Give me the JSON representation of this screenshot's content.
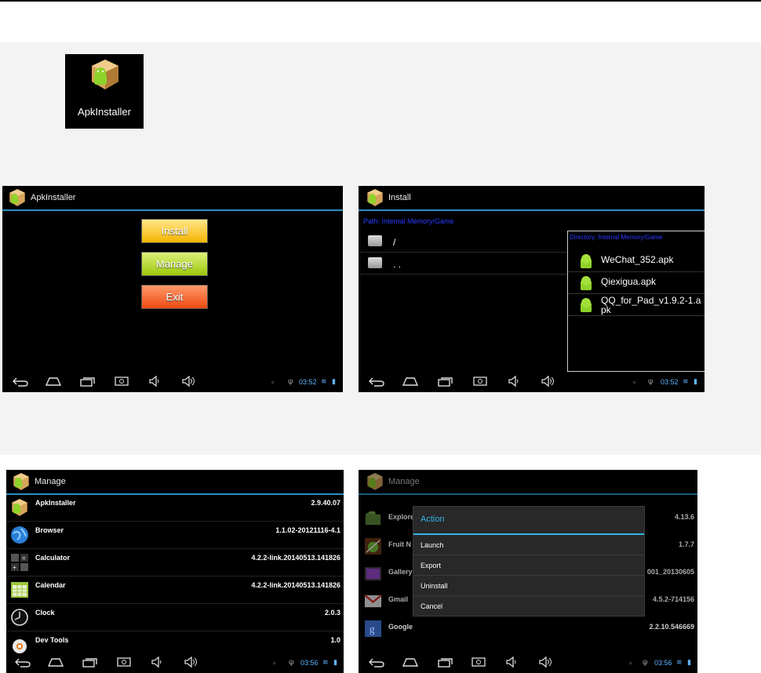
{
  "launcher": {
    "label": "ApkInstaller"
  },
  "screen_main": {
    "title": "ApkInstaller",
    "install_label": "Install",
    "manage_label": "Manage",
    "exit_label": "Exit",
    "time": "03:52"
  },
  "screen_install": {
    "title": "Install",
    "path_label": "Path: Internal Memory/Game",
    "folders": [
      "/",
      ". ."
    ],
    "directory_label": "Directory: Internal Memory/Game",
    "apks": [
      "WeChat_352.apk",
      "Qiexigua.apk",
      "QQ_for_Pad_v1.9.2-1.apk"
    ],
    "time": "03:52"
  },
  "screen_manage": {
    "title": "Manage",
    "apps": [
      {
        "name": "ApkInstaller",
        "version": "2.9.40.07",
        "icon": "apk-installer-icon"
      },
      {
        "name": "Browser",
        "version": "1.1.02-20121116-4.1",
        "icon": "browser-globe-icon"
      },
      {
        "name": "Calculator",
        "version": "4.2.2-link.20140513.141826",
        "icon": "calculator-icon"
      },
      {
        "name": "Calendar",
        "version": "4.2.2-link.20140513.141826",
        "icon": "calendar-icon"
      },
      {
        "name": "Clock",
        "version": "2.0.3",
        "icon": "clock-icon"
      },
      {
        "name": "Dev Tools",
        "version": "1.0",
        "icon": "dev-tools-gear-icon"
      }
    ],
    "time": "03:56"
  },
  "screen_action": {
    "title": "Manage",
    "apps": [
      {
        "name": "Explore",
        "version": "4.13.6",
        "icon": "explorer-icon"
      },
      {
        "name": "Fruit N",
        "version": "1.7.7",
        "icon": "fruit-ninja-icon"
      },
      {
        "name": "Gallery",
        "version": "001_20130605",
        "icon": "gallery-icon"
      },
      {
        "name": "Gmail",
        "version": "4.5.2-714156",
        "icon": "gmail-icon"
      },
      {
        "name": "Google",
        "version": "2.2.10.546669",
        "icon": "google-icon"
      }
    ],
    "dialog": {
      "title": "Action",
      "items": [
        "Launch",
        "Export",
        "Uninstall",
        "Cancel"
      ]
    },
    "time": "03:56"
  },
  "colors": {
    "accent": "#33b5e5",
    "clock": "#5fb3ff",
    "path_blue": "#2b3bff"
  }
}
